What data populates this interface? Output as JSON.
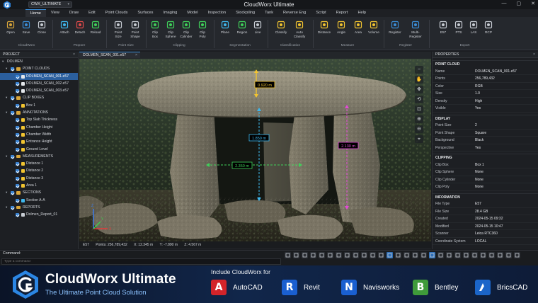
{
  "app": {
    "title": "CloudWorx Ultimate",
    "workspace": "CWX_ULTIMATE"
  },
  "window_controls": [
    "—",
    "▢",
    "✕"
  ],
  "menu": [
    "Home",
    "View",
    "Draw",
    "Edit",
    "Point Clouds",
    "Surfaces",
    "Imaging",
    "Model",
    "Inspection",
    "Stockpiling",
    "Tank",
    "Reverse Eng",
    "Script",
    "Report",
    "Help"
  ],
  "menu_active": "Home",
  "ribbon": {
    "tools": [
      {
        "label": "Open"
      },
      {
        "label": "Save"
      },
      {
        "label": "Close"
      },
      {
        "label": "Attach"
      },
      {
        "label": "Detach"
      },
      {
        "label": "Reload"
      },
      {
        "label": "Point\nSize"
      },
      {
        "label": "Point\nShape"
      },
      {
        "label": "Clip\nBox"
      },
      {
        "label": "Clip\nSphere"
      },
      {
        "label": "Clip\nCylinder"
      },
      {
        "label": "Clip\nPoly"
      },
      {
        "label": "Plane"
      },
      {
        "label": "Region"
      },
      {
        "label": "Line"
      },
      {
        "label": "Classify"
      },
      {
        "label": "Auto\nClassify"
      },
      {
        "label": "Distance"
      },
      {
        "label": "Angle"
      },
      {
        "label": "Area"
      },
      {
        "label": "Volume"
      },
      {
        "label": "Register"
      },
      {
        "label": "Multi-Register"
      },
      {
        "label": "E57"
      },
      {
        "label": "PTS"
      },
      {
        "label": "LAS"
      },
      {
        "label": "RCP"
      }
    ],
    "groups": [
      "CloudWorx",
      "Ptopore",
      "Point Size",
      "Clipping",
      "Segmentation",
      "Classification",
      "Measure",
      "Register",
      "Export"
    ]
  },
  "project": {
    "title": "PROJECT",
    "root": "DOLMEN",
    "sections": [
      {
        "name": "POINT CLOUDS",
        "items": [
          "DOLMEN_SCAN_001.e57",
          "DOLMEN_SCAN_002.e57",
          "DOLMEN_SCAN_003.e57"
        ]
      },
      {
        "name": "CLIP BOXES",
        "items": [
          "Box 1"
        ]
      },
      {
        "name": "ANNOTATIONS",
        "items": [
          "Top Slab Thickness",
          "Chamber Height",
          "Chamber Width",
          "Entrance Height",
          "Ground Level"
        ]
      },
      {
        "name": "MEASUREMENTS",
        "items": [
          "Distance 1",
          "Distance 2",
          "Distance 3",
          "Area 1"
        ]
      },
      {
        "name": "SECTIONS",
        "items": [
          "Section A-A"
        ]
      },
      {
        "name": "REPORTS",
        "items": [
          "Dolmen_Report_01"
        ]
      }
    ],
    "selected": "DOLMEN_SCAN_001.e57"
  },
  "viewport": {
    "tab": "DOLMEN_SCAN_001.e57",
    "labels": {
      "top_slab": "0.920 m",
      "chamber_height": "1.850 m",
      "chamber_width": "2.350 m",
      "entrance_height": "2.130 m"
    },
    "status": {
      "format": "E57",
      "points": "Points: 256,789,432",
      "x": "X: 12.345 m",
      "y": "Y: -7.890 m",
      "z": "Z: 4.567 m"
    },
    "axes": {
      "x": "X",
      "y": "Y",
      "z": "Z"
    }
  },
  "properties": {
    "title": "PROPERTIES",
    "sections": [
      {
        "name": "POINT CLOUD",
        "rows": [
          [
            "Name",
            "DOLMEN_SCAN_001.e57"
          ],
          [
            "Points",
            "256,789,432"
          ],
          [
            "Color",
            "RGB"
          ],
          [
            "Size",
            "1.0"
          ],
          [
            "Density",
            "High"
          ],
          [
            "Visible",
            "Yes"
          ]
        ]
      },
      {
        "name": "DISPLAY",
        "rows": [
          [
            "Point Size",
            "2"
          ],
          [
            "Point Shape",
            "Square"
          ],
          [
            "Background",
            "Black"
          ],
          [
            "Perspective",
            "Yes"
          ]
        ]
      },
      {
        "name": "CLIPPING",
        "rows": [
          [
            "Clip Box",
            "Box 1"
          ],
          [
            "Clip Sphere",
            "None"
          ],
          [
            "Clip Cylinder",
            "None"
          ],
          [
            "Clip Poly",
            "None"
          ]
        ]
      },
      {
        "name": "INFORMATION",
        "rows": [
          [
            "File Type",
            "E57"
          ],
          [
            "File Size",
            "28.4 GB"
          ],
          [
            "Created",
            "2024-05-15 09:32"
          ],
          [
            "Modified",
            "2024-05-15 10:47"
          ],
          [
            "Scanner",
            "Leica RTC360"
          ],
          [
            "Coordinate System",
            "LOCAL"
          ]
        ]
      }
    ]
  },
  "command": {
    "label": "Command:",
    "placeholder": "Type a command"
  },
  "banner": {
    "name": "CloudWorx Ultimate",
    "tagline": "The Ultimate Point Cloud Solution",
    "include": "Include CloudWorx for",
    "products": [
      {
        "name": "AutoCAD",
        "letter": "A",
        "color": "#d3242a"
      },
      {
        "name": "Revit",
        "letter": "R",
        "color": "#1a5fd0"
      },
      {
        "name": "Navisworks",
        "letter": "N",
        "color": "#1a5fd0"
      },
      {
        "name": "Bentley",
        "letter": "B",
        "color": "#3f9b3a"
      },
      {
        "name": "BricsCAD",
        "letter": "",
        "color": "#1b65c9"
      }
    ]
  },
  "colors": {
    "accent": "#3b8ed8",
    "measure_yellow": "#f2c430",
    "measure_cyan": "#3fb8ee",
    "measure_green": "#3fd15a",
    "measure_magenta": "#e24bd6"
  }
}
